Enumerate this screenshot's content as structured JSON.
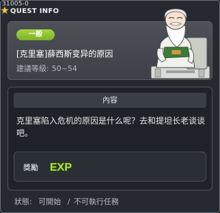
{
  "window": {
    "quest_id": "31005-0",
    "title": "QUEST INFO"
  },
  "header": {
    "category": "一般",
    "quest_title": "[克里塞]薛西斯变异的原因",
    "level_label": "建議等級:",
    "level_range": "50~54"
  },
  "content": {
    "section_title": "內容",
    "description": "克里塞陷入危机的原因是什么呢？去和提坦长老谈谈吧。",
    "reward_label": "獎勵",
    "reward_type": "EXP"
  },
  "status": {
    "label": "狀態:",
    "value": "可開始",
    "separator": "/",
    "note": "不可執行任務"
  },
  "colors": {
    "window_bg": "#262a30",
    "category_green": "#8cc634",
    "exp_green": "#a8e13a"
  },
  "icons": {
    "title": "star-icon",
    "npc": "elder-npc-portrait",
    "reward": "exp-icon"
  }
}
